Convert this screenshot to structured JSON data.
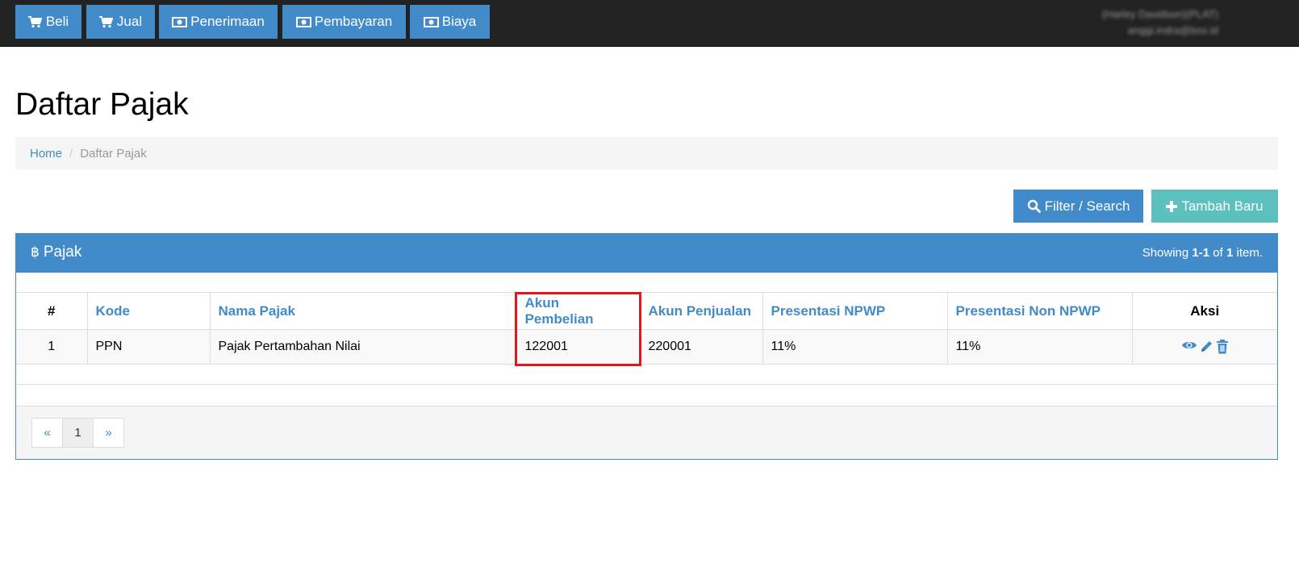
{
  "navbar": {
    "buttons": [
      {
        "label": "Beli",
        "icon": "cart-icon"
      },
      {
        "label": "Jual",
        "icon": "cart-icon"
      },
      {
        "label": "Penerimaan",
        "icon": "money-icon"
      },
      {
        "label": "Pembayaran",
        "icon": "money-icon"
      },
      {
        "label": "Biaya",
        "icon": "money-icon"
      }
    ],
    "user_name": "(Harley Davidson)(PLAT)",
    "user_email": "anggi.indra@bos.id"
  },
  "page": {
    "title": "Daftar Pajak"
  },
  "breadcrumb": {
    "home": "Home",
    "separator": "/",
    "current": "Daftar Pajak"
  },
  "actions": {
    "filter_label": "Filter / Search",
    "add_label": "Tambah Baru"
  },
  "panel": {
    "title": "Pajak",
    "icon": "baht-icon",
    "summary_prefix": "Showing ",
    "summary_range": "1-1",
    "summary_mid": " of ",
    "summary_total": "1",
    "summary_suffix": " item."
  },
  "table": {
    "columns": [
      "#",
      "Kode",
      "Nama Pajak",
      "Akun Pembelian",
      "Akun Penjualan",
      "Presentasi NPWP",
      "Presentasi Non NPWP",
      "Aksi"
    ],
    "rows": [
      {
        "no": "1",
        "kode": "PPN",
        "nama": "Pajak Pertambahan Nilai",
        "akun_pembelian": "122001",
        "akun_penjualan": "220001",
        "npwp": "11%",
        "non_npwp": "11%"
      }
    ],
    "row_actions": [
      "eye-icon",
      "pencil-icon",
      "trash-icon"
    ]
  },
  "pagination": {
    "prev": "«",
    "pages": [
      "1"
    ],
    "next": "»",
    "current": "1"
  },
  "colors": {
    "primary": "#428bca",
    "success": "#5bc0be",
    "navbar": "#222222",
    "highlight": "#e4171b"
  }
}
